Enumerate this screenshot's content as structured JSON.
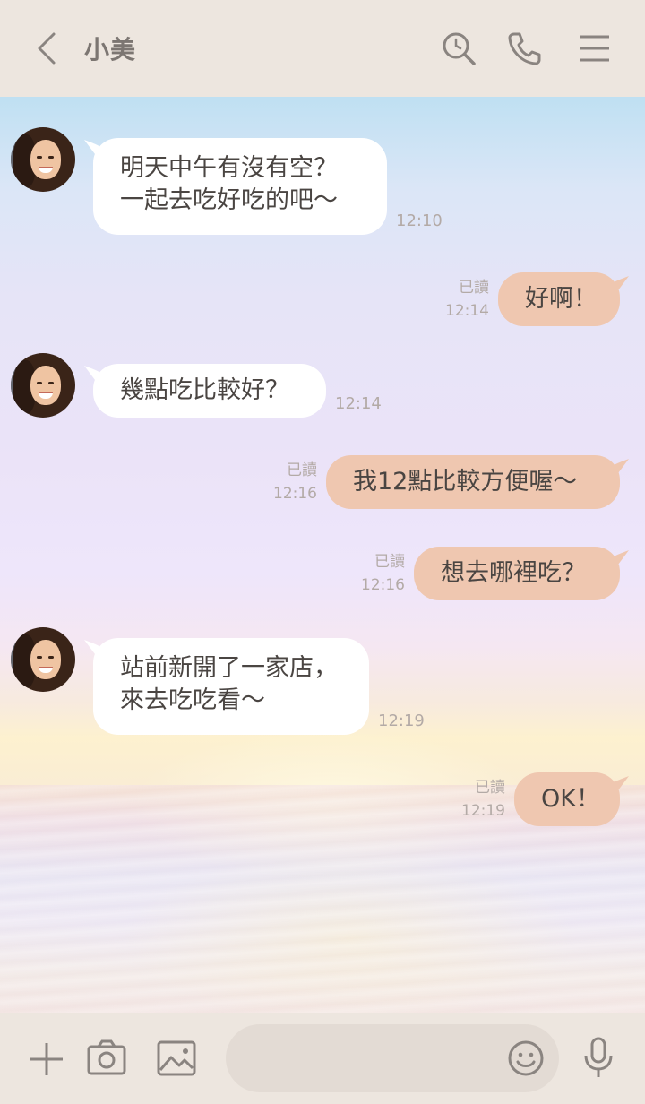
{
  "header": {
    "title": "小美",
    "icons": [
      "back-icon",
      "search-icon",
      "phone-icon",
      "menu-icon"
    ]
  },
  "messages": [
    {
      "side": "in",
      "text": "明天中午有沒有空？\n一起去吃好吃的吧～",
      "time": "12:10"
    },
    {
      "side": "out",
      "text": "好啊！",
      "read": "已讀",
      "time": "12:14"
    },
    {
      "side": "in",
      "text": "幾點吃比較好？",
      "time": "12:14"
    },
    {
      "side": "out",
      "text": "我12點比較方便喔～",
      "read": "已讀",
      "time": "12:16"
    },
    {
      "side": "out",
      "text": "想去哪裡吃？",
      "read": "已讀",
      "time": "12:16"
    },
    {
      "side": "in",
      "text": "站前新開了一家店，\n來去吃吃看～",
      "time": "12:19"
    },
    {
      "side": "out",
      "text": "OK！",
      "read": "已讀",
      "time": "12:19"
    }
  ],
  "footer": {
    "icons": [
      "plus-icon",
      "camera-icon",
      "image-icon",
      "emoji-icon",
      "microphone-icon"
    ],
    "input_value": ""
  },
  "colors": {
    "header_bg": "#ede6df",
    "incoming_bubble": "#ffffff",
    "outgoing_bubble": "#efc7b0",
    "text": "#4a4542",
    "meta_text": "#b3aaa6"
  }
}
